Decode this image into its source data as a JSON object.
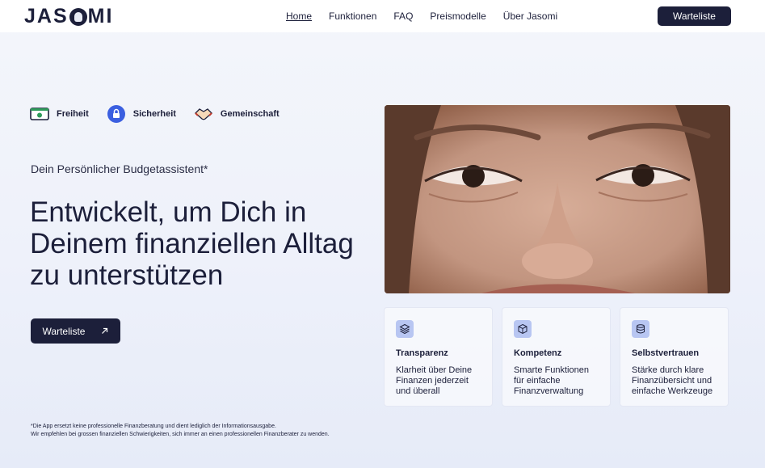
{
  "header": {
    "logo": "JASOMI",
    "nav": [
      "Home",
      "Funktionen",
      "FAQ",
      "Preismodelle",
      "Über Jasomi"
    ],
    "cta_label": "Warteliste"
  },
  "values": [
    {
      "label": "Freiheit",
      "icon": "money-icon"
    },
    {
      "label": "Sicherheit",
      "icon": "lock-icon"
    },
    {
      "label": "Gemeinschaft",
      "icon": "handshake-icon"
    }
  ],
  "hero": {
    "subtitle": "Dein Persönlicher Budgetassistent*",
    "headline_lines": [
      "Entwickelt, um Dich in",
      "Deinem finanziellen Alltag",
      "zu unterstützen"
    ],
    "cta_label": "Warteliste",
    "cta_icon": "arrow-up-right-icon"
  },
  "features": [
    {
      "title": "Transparenz",
      "text": "Klarheit über Deine Finanzen jederzeit und überall",
      "icon": "layers-icon"
    },
    {
      "title": "Kompetenz",
      "text": "Smarte Funktionen für einfache Finanzverwaltung",
      "icon": "cube-icon"
    },
    {
      "title": "Selbstvertrauen",
      "text": "Stärke durch klare Finanzübersicht und einfache Werkzeuge",
      "icon": "database-icon"
    }
  ],
  "disclaimer": [
    "*Die App ersetzt keine professionelle Finanzberatung und dient lediglich der Informationsausgabe.",
    "Wir empfehlen bei grossen finanziellen Schwierigkeiten, sich immer an einen professionellen Finanzberater zu wenden."
  ],
  "colors": {
    "primary": "#1c1f3a",
    "accent": "#3b5fe0",
    "icon_bg": "#b8c6f2"
  }
}
